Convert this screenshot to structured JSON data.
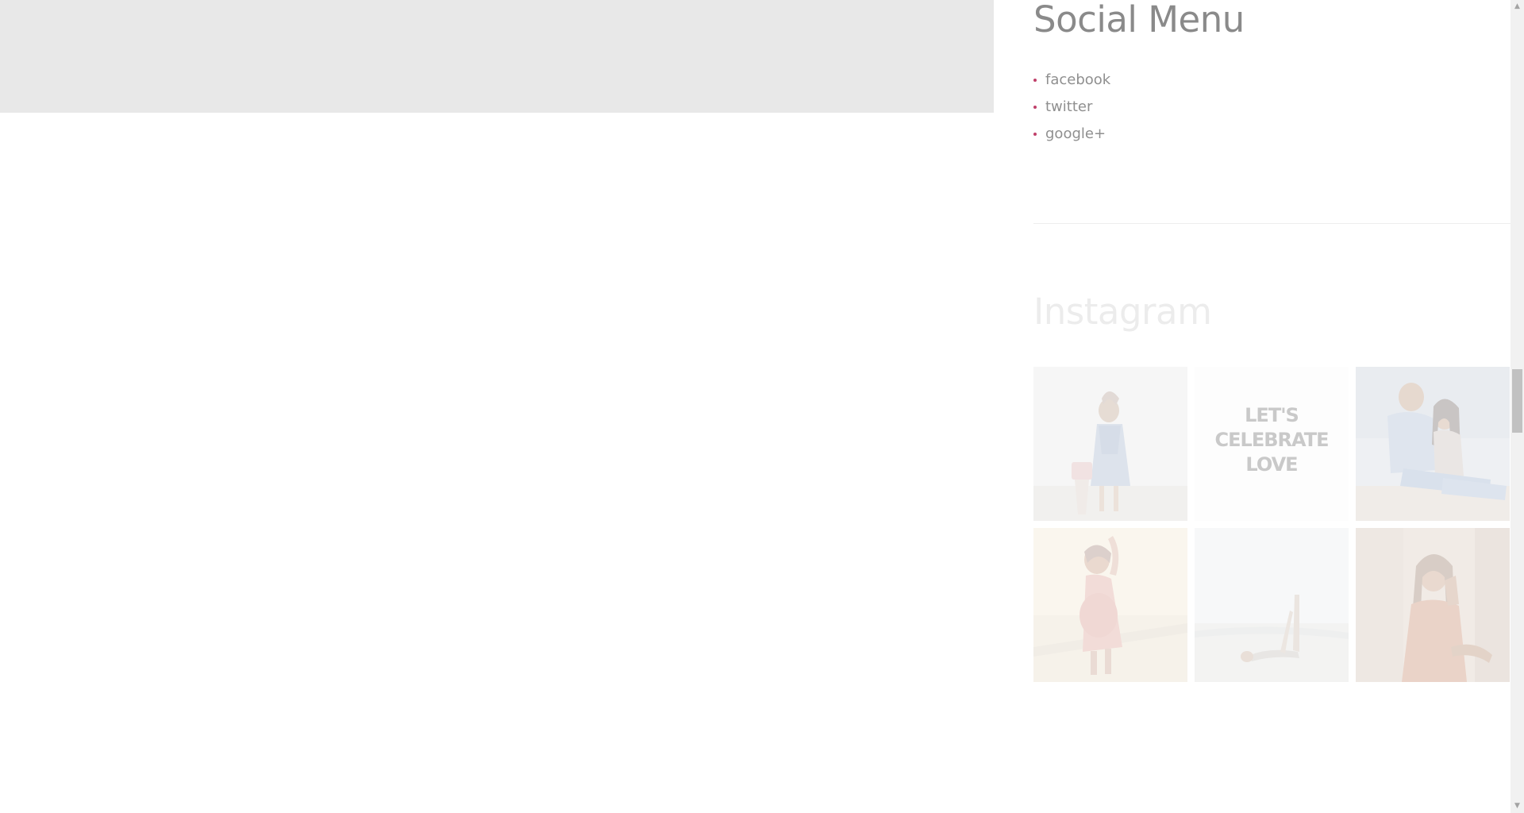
{
  "top_block": {
    "color": "#e8e8e8"
  },
  "sidebar": {
    "social_menu": {
      "title": "Social Menu",
      "items": [
        {
          "label": "facebook"
        },
        {
          "label": "twitter"
        },
        {
          "label": "google+"
        }
      ],
      "bullet_color": "#c0406a"
    },
    "instagram": {
      "title": "Instagram",
      "tiles": [
        {
          "description": "woman-in-denim-dress-photo"
        },
        {
          "text": "LET'S\nCELEBRATE\nLOVE"
        },
        {
          "description": "couple-sitting-photo"
        },
        {
          "description": "woman-in-pink-dress-photo"
        },
        {
          "description": "woman-lying-on-beach-photo"
        },
        {
          "description": "woman-by-window-photo"
        }
      ]
    }
  },
  "scrollbar": {
    "up_icon": "triangle-up",
    "down_icon": "triangle-down",
    "up_glyph": "▲",
    "down_glyph": "▼"
  }
}
